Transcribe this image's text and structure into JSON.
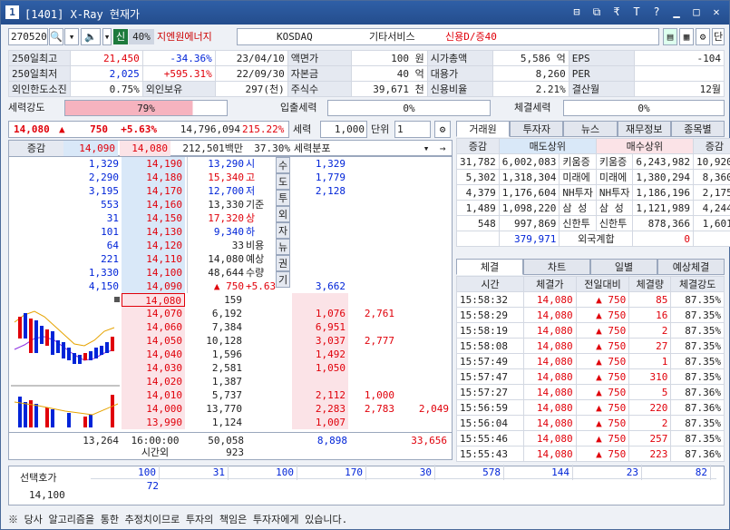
{
  "title": {
    "badge": "1",
    "text": "[1401] X-Ray 현재가",
    "controls": [
      "⊟",
      "⧉",
      "₹",
      "T",
      "?",
      "▁",
      "□",
      "✕"
    ]
  },
  "toolbar": {
    "code": "270520",
    "sin": "신",
    "pct": "40%",
    "name": "지엔원에너지",
    "market": "KOSDAQ",
    "sector": "기타서비스",
    "credit": "신용D/증40",
    "btn_last": "단"
  },
  "info": {
    "rows": [
      [
        "250일최고",
        "21,450",
        "-34.36%",
        "23/04/10",
        "액면가",
        "100 원",
        "시가총액",
        "5,586 억",
        "EPS",
        "-104"
      ],
      [
        "250일최저",
        "2,025",
        "+595.31%",
        "22/09/30",
        "자본금",
        "40 억",
        "대용가",
        "8,260",
        "PER",
        ""
      ],
      [
        "외인한도소진",
        "0.75%",
        "외인보유",
        "297(천)",
        "주식수",
        "39,671 천",
        "신용비율",
        "2.21%",
        "결산월",
        "12월"
      ]
    ]
  },
  "strength": {
    "label": "세력강도",
    "val": "79%",
    "label2": "입출세력",
    "val2": "0%",
    "label3": "체결세력",
    "val3": "0%"
  },
  "quote": {
    "price": "14,080",
    "change": "750",
    "rate": "+5.63%",
    "volume": "14,796,094",
    "vol_rate": "215.22%",
    "force_label": "세력",
    "force_val": "1,000",
    "unit_label": "단위",
    "unit_val": "1"
  },
  "ob_hdr": {
    "label": "증감",
    "p1": "14,090",
    "p2": "14,080",
    "amount": "212,501백만",
    "pct": "37.30%",
    "dist": "세력분포"
  },
  "asks": [
    {
      "qty": "1,329",
      "price": "14,190",
      "f": "1,329"
    },
    {
      "qty": "2,290",
      "price": "14,180",
      "f": "1,779"
    },
    {
      "qty": "3,195",
      "price": "14,170",
      "f": "2,128"
    },
    {
      "qty": "553",
      "price": "14,160",
      "f": ""
    },
    {
      "qty": "31",
      "price": "14,150",
      "f": ""
    },
    {
      "qty": "101",
      "price": "14,130",
      "f": ""
    },
    {
      "qty": "64",
      "price": "14,120",
      "f": ""
    },
    {
      "qty": "221",
      "price": "14,110",
      "f": ""
    },
    {
      "qty": "1,330",
      "price": "14,100",
      "f": ""
    },
    {
      "qty": "4,150",
      "price": "14,090",
      "f": "3,662"
    }
  ],
  "mid": [
    {
      "v": "13,290",
      "k": "시"
    },
    {
      "v": "15,340",
      "k": "고"
    },
    {
      "v": "12,700",
      "k": "저"
    },
    {
      "v": "13,330",
      "k": "기준"
    },
    {
      "v": "17,320",
      "k": "상"
    },
    {
      "v": "9,340",
      "k": "하"
    },
    {
      "v": "33",
      "k": "비용"
    },
    {
      "v": "14,080",
      "k": "예상"
    },
    {
      "v": "48,644",
      "k": "수량"
    },
    {
      "v": "▲ 750",
      "k": "+5.63%"
    }
  ],
  "side": [
    "수",
    "도",
    "투",
    "외",
    "자",
    "뉴",
    "권",
    "기"
  ],
  "bids": [
    {
      "price": "14,080",
      "qty": "159",
      "f1": "",
      "f2": "",
      "f3": ""
    },
    {
      "price": "14,070",
      "qty": "6,192",
      "f1": "1,076",
      "f2": "2,761",
      "f3": ""
    },
    {
      "price": "14,060",
      "qty": "7,384",
      "f1": "6,951",
      "f2": "",
      "f3": ""
    },
    {
      "price": "14,050",
      "qty": "10,128",
      "f1": "3,037",
      "f2": "2,777",
      "f3": ""
    },
    {
      "price": "14,040",
      "qty": "1,596",
      "f1": "1,492",
      "f2": "",
      "f3": ""
    },
    {
      "price": "14,030",
      "qty": "2,581",
      "f1": "1,050",
      "f2": "",
      "f3": ""
    },
    {
      "price": "14,020",
      "qty": "1,387",
      "f1": "",
      "f2": "",
      "f3": ""
    },
    {
      "price": "14,010",
      "qty": "5,737",
      "f1": "2,112",
      "f2": "1,000",
      "f3": ""
    },
    {
      "price": "14,000",
      "qty": "13,770",
      "f1": "2,283",
      "f2": "2,783",
      "f3": "2,049"
    },
    {
      "price": "13,990",
      "qty": "1,124",
      "f1": "1,007",
      "f2": "",
      "f3": ""
    }
  ],
  "totals": {
    "ask": "13,264",
    "time": "16:00:00",
    "bid": "50,058",
    "f1": "8,898",
    "f3": "33,656",
    "after_label": "시간외",
    "after": "923"
  },
  "broker": {
    "tabs": [
      "거래원",
      "투자자",
      "뉴스",
      "재무정보",
      "종목별"
    ],
    "hdr": [
      "증감",
      "매도상위",
      "매수상위",
      "증감"
    ],
    "rows": [
      [
        "31,782",
        "6,002,083",
        "키움증",
        "키움증",
        "6,243,982",
        "10,920"
      ],
      [
        "5,302",
        "1,318,304",
        "미래에",
        "미래에",
        "1,380,294",
        "8,360"
      ],
      [
        "4,379",
        "1,176,604",
        "NH투자",
        "NH투자",
        "1,186,196",
        "2,175"
      ],
      [
        "1,489",
        "1,098,220",
        "삼 성",
        "삼 성",
        "1,121,989",
        "4,244"
      ],
      [
        "548",
        "997,869",
        "신한투",
        "신한투",
        "878,366",
        "1,601"
      ]
    ],
    "foreign": [
      "379,971",
      "외국계합",
      "0"
    ]
  },
  "trades": {
    "tabs": [
      "체결",
      "차트",
      "일별",
      "예상체결"
    ],
    "hdr": [
      "시간",
      "체결가",
      "전일대비",
      "체결량",
      "체결강도"
    ],
    "rows": [
      [
        "15:58:32",
        "14,080",
        "750",
        "85",
        "87.35%"
      ],
      [
        "15:58:29",
        "14,080",
        "750",
        "16",
        "87.35%"
      ],
      [
        "15:58:19",
        "14,080",
        "750",
        "2",
        "87.35%"
      ],
      [
        "15:58:08",
        "14,080",
        "750",
        "27",
        "87.35%"
      ],
      [
        "15:57:49",
        "14,080",
        "750",
        "1",
        "87.35%"
      ],
      [
        "15:57:47",
        "14,080",
        "750",
        "310",
        "87.35%"
      ],
      [
        "15:57:27",
        "14,080",
        "750",
        "5",
        "87.36%"
      ],
      [
        "15:56:59",
        "14,080",
        "750",
        "220",
        "87.36%"
      ],
      [
        "15:56:04",
        "14,080",
        "750",
        "2",
        "87.35%"
      ],
      [
        "15:55:46",
        "14,080",
        "750",
        "257",
        "87.35%"
      ],
      [
        "15:55:43",
        "14,080",
        "750",
        "223",
        "87.36%"
      ]
    ]
  },
  "select": {
    "label": "선택호가",
    "price": "14,100",
    "row1": [
      "100",
      "31",
      "100",
      "170",
      "30",
      "578",
      "144",
      "23",
      "82"
    ],
    "row2": [
      "72"
    ]
  },
  "footer": "※ 당사 알고리즘을 통한 추정치이므로 투자의 책임은 투자자에게 있습니다.",
  "colors": {
    "up": "#e0000a",
    "down": "#0024d8",
    "ask_bg": "#d9e8f8",
    "bid_bg": "#fbe3e7"
  }
}
